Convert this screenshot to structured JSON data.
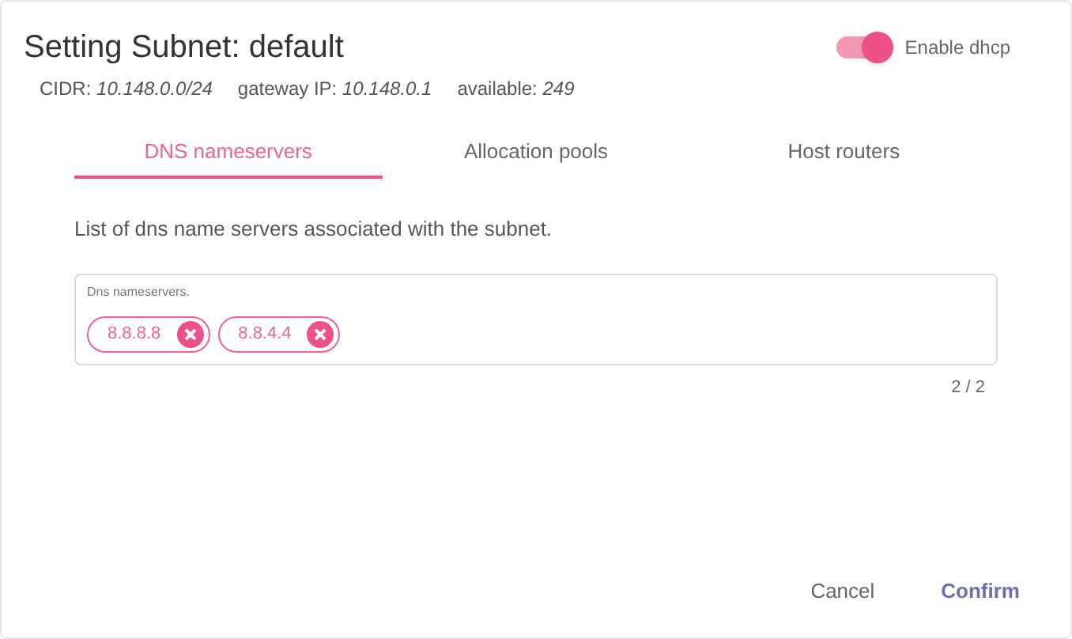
{
  "dialog": {
    "title": "Setting Subnet: default"
  },
  "dhcp": {
    "label": "Enable dhcp",
    "on": true
  },
  "info": [
    {
      "label": "CIDR:",
      "value": "10.148.0.0/24"
    },
    {
      "label": "gateway IP:",
      "value": "10.148.0.1"
    },
    {
      "label": "available:",
      "value": "249"
    }
  ],
  "tabs": [
    {
      "label": "DNS nameservers",
      "selected": true
    },
    {
      "label": "Allocation pools",
      "selected": false
    },
    {
      "label": "Host routers",
      "selected": false
    }
  ],
  "description": "List of dns name servers associated with the subnet.",
  "field": {
    "label": "Dns nameservers.",
    "chips": [
      "8.8.8.8",
      "8.8.4.4"
    ],
    "counter": "2 / 2"
  },
  "buttons": [
    {
      "label": "Cancel",
      "kind": "secondary"
    },
    {
      "label": "Confirm",
      "kind": "primary"
    }
  ]
}
